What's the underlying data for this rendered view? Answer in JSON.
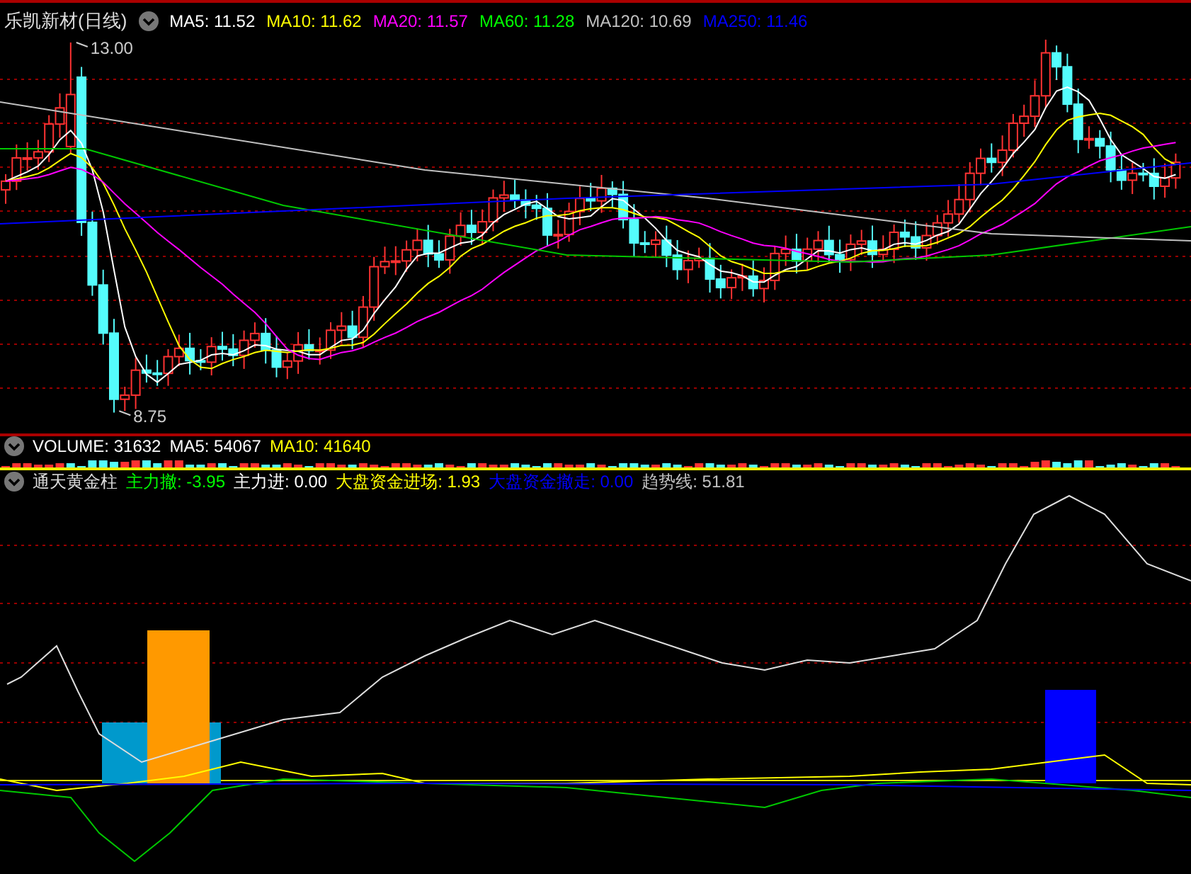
{
  "title": "乐凯新材(日线)",
  "ma_legend": [
    {
      "label": "MA5: 11.52",
      "color": "#ffffff"
    },
    {
      "label": "MA10: 11.62",
      "color": "#ffff00"
    },
    {
      "label": "MA20: 11.57",
      "color": "#ff00ff"
    },
    {
      "label": "MA60: 11.28",
      "color": "#00ff00"
    },
    {
      "label": "MA120: 10.69",
      "color": "#c0c0c0"
    },
    {
      "label": "MA250: 11.46",
      "color": "#0000ff"
    }
  ],
  "price_labels": [
    {
      "kind": "high",
      "text": "13.00"
    },
    {
      "kind": "low",
      "text": "8.75"
    }
  ],
  "volume_legend": [
    {
      "label": "VOLUME: 31632",
      "color": "#ffffff"
    },
    {
      "label": "MA5: 54067",
      "color": "#ffffff"
    },
    {
      "label": "MA10: 41640",
      "color": "#ffff00"
    }
  ],
  "indicator": {
    "title": "通天黄金柱",
    "legend": [
      {
        "label": "主力撤: -3.95",
        "color": "#00ff00"
      },
      {
        "label": "主力进: 0.00",
        "color": "#ffffff"
      },
      {
        "label": "大盘资金进场: 1.93",
        "color": "#ffff00"
      },
      {
        "label": "大盘资金撤走: 0.00",
        "color": "#0000ff"
      },
      {
        "label": "趋势线: 51.81",
        "color": "#c0c0c0"
      }
    ]
  }
}
